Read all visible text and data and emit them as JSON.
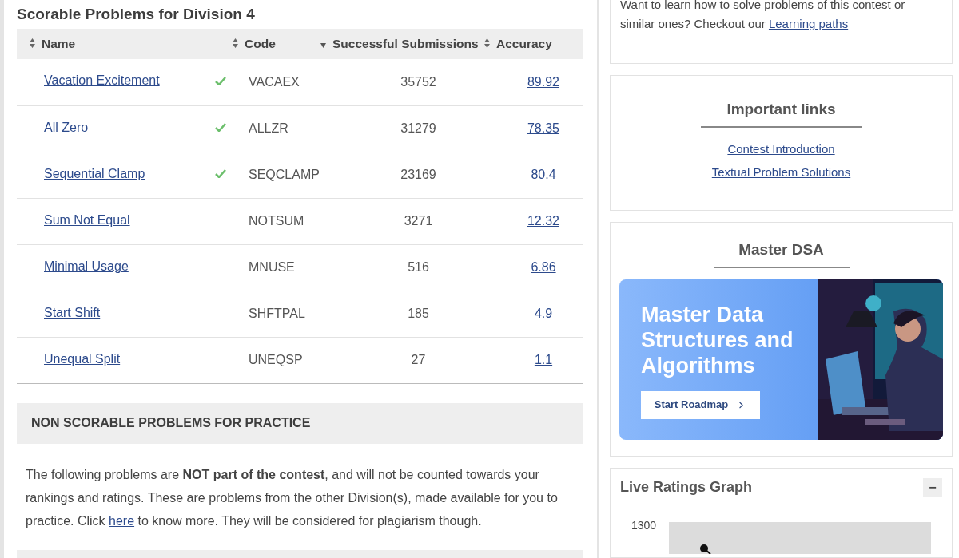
{
  "scorable": {
    "title": "Scorable Problems for Division 4",
    "columns": [
      {
        "label": "Name",
        "kind": "sortable"
      },
      {
        "label": "Code",
        "kind": "sortable"
      },
      {
        "label": "Successful Submissions",
        "kind": "sorted"
      },
      {
        "label": "Accuracy",
        "kind": "sortable"
      }
    ],
    "rows": [
      {
        "name": "Vacation Excitement",
        "solved": true,
        "code": "VACAEX",
        "submissions": "35752",
        "accuracy": "89.92"
      },
      {
        "name": "All Zero",
        "solved": true,
        "code": "ALLZR",
        "submissions": "31279",
        "accuracy": "78.35"
      },
      {
        "name": "Sequential Clamp",
        "solved": true,
        "code": "SEQCLAMP",
        "submissions": "23169",
        "accuracy": "80.4"
      },
      {
        "name": "Sum Not Equal",
        "solved": false,
        "code": "NOTSUM",
        "submissions": "3271",
        "accuracy": "12.32"
      },
      {
        "name": "Minimal Usage",
        "solved": false,
        "code": "MNUSE",
        "submissions": "516",
        "accuracy": "6.86"
      },
      {
        "name": "Start Shift",
        "solved": false,
        "code": "SHFTPAL",
        "submissions": "185",
        "accuracy": "4.9"
      },
      {
        "name": "Unequal Split",
        "solved": false,
        "code": "UNEQSP",
        "submissions": "27",
        "accuracy": "1.1"
      }
    ]
  },
  "non_scorable": {
    "title": "NON SCORABLE PROBLEMS FOR PRACTICE",
    "text_before": "The following problems are **NOT part of the contest**, and will not be counted towards your rankings and ratings. These are problems from the other Division(s), made available for you to practice. Click",
    "link": "here",
    "text_after": "to know more. They will be considered for plagiarism though."
  },
  "learn": {
    "text": "Want to learn how to solve problems of this contest or similar ones? Checkout our",
    "link": "Learning paths"
  },
  "important_links": {
    "title": "Important links",
    "links": [
      "Contest Introduction",
      "Textual Problem Solutions"
    ]
  },
  "master_dsa": {
    "title": "Master DSA",
    "banner_title": "Master Data Structures and Algorithms",
    "button": "Start Roadmap"
  },
  "ratings_graph": {
    "title": "Live Ratings Graph",
    "collapse": "−",
    "y_tick": "1300"
  }
}
